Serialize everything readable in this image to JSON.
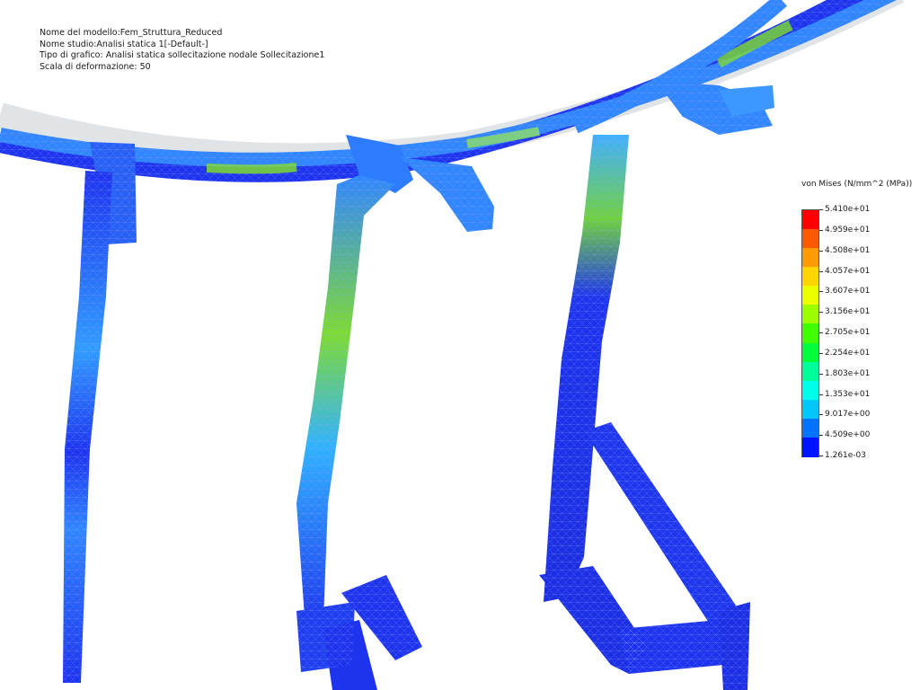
{
  "info": {
    "model_name": "Nome del modello:Fem_Struttura_Reduced",
    "study_name": "Nome studio:Analisi statica 1[-Default-]",
    "plot_type": "Tipo di grafico: Analisi statica sollecitazione nodale Sollecitazione1",
    "deformation_scale": "Scala di deformazione: 50"
  },
  "legend": {
    "title": "von Mises (N/mm^2 (MPa))",
    "labels": [
      "5.410e+01",
      "4.959e+01",
      "4.508e+01",
      "4.057e+01",
      "3.607e+01",
      "3.156e+01",
      "2.705e+01",
      "2.254e+01",
      "1.803e+01",
      "1.353e+01",
      "9.017e+00",
      "4.509e+00",
      "1.261e-03"
    ],
    "colors": [
      "#ff0000",
      "#ff5a00",
      "#ff9a00",
      "#ffd500",
      "#eaff00",
      "#9cff00",
      "#3dff00",
      "#00ff3a",
      "#00ff98",
      "#00ffe6",
      "#00c8ff",
      "#0073ff",
      "#0015ff"
    ]
  },
  "colors": {
    "mesh_base": "#1d33ee",
    "mesh_mid": "#2f86ff",
    "mesh_hot": "#7ddc2c",
    "undeformed": "#c9cdd2"
  }
}
